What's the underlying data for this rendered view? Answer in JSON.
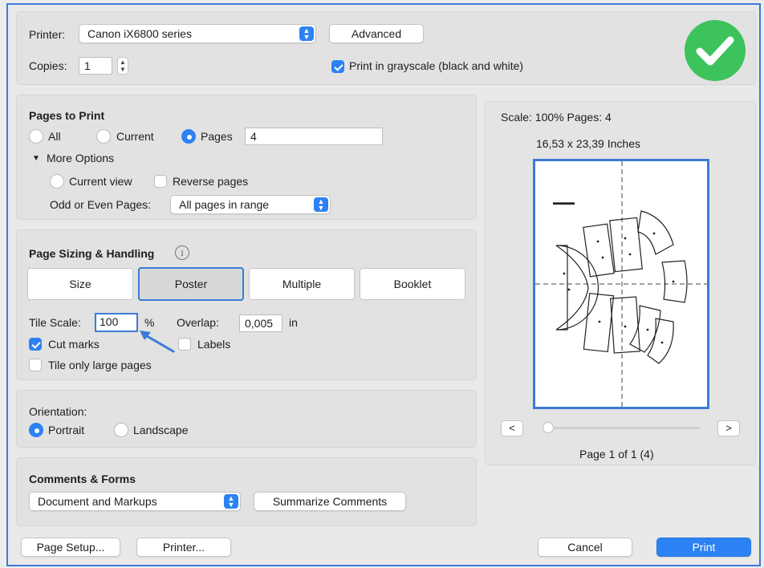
{
  "printer": {
    "label": "Printer:",
    "value": "Canon iX6800 series",
    "advanced_label": "Advanced"
  },
  "copies": {
    "label": "Copies:",
    "value": "1"
  },
  "grayscale": {
    "label": "Print in grayscale (black and white)",
    "checked": true
  },
  "pages_to_print": {
    "title": "Pages to Print",
    "all_label": "All",
    "current_label": "Current",
    "pages_label": "Pages",
    "pages_value": "4",
    "more_options_label": "More Options",
    "current_view_label": "Current view",
    "reverse_pages_label": "Reverse pages",
    "odd_even_label": "Odd or Even Pages:",
    "odd_even_value": "All pages in range"
  },
  "sizing": {
    "title": "Page Sizing & Handling",
    "info_icon": "info-icon",
    "tabs": [
      {
        "label": "Size"
      },
      {
        "label": "Poster"
      },
      {
        "label": "Multiple"
      },
      {
        "label": "Booklet"
      }
    ],
    "selected_tab": "Poster",
    "tile_scale_label": "Tile Scale:",
    "tile_scale_value": "100",
    "tile_scale_unit": "%",
    "overlap_label": "Overlap:",
    "overlap_value": "0,005",
    "overlap_unit": "in",
    "cut_marks_label": "Cut marks",
    "cut_marks_checked": true,
    "labels_label": "Labels",
    "labels_checked": false,
    "tile_large_label": "Tile only large pages",
    "tile_large_checked": false
  },
  "orientation": {
    "title": "Orientation:",
    "portrait_label": "Portrait",
    "landscape_label": "Landscape",
    "selected": "Portrait"
  },
  "comments": {
    "title": "Comments & Forms",
    "value": "Document and Markups",
    "summarize_label": "Summarize Comments"
  },
  "preview": {
    "scale_text": "Scale: 100% Pages: 4",
    "dimensions": "16,53 x 23,39 Inches",
    "page_text": "Page 1 of 1 (4)",
    "prev_label": "<",
    "next_label": ">"
  },
  "footer": {
    "page_setup_label": "Page Setup...",
    "printer_label": "Printer...",
    "cancel_label": "Cancel",
    "print_label": "Print"
  },
  "colors": {
    "accent": "#2c82f3",
    "success": "#3cc35b"
  }
}
